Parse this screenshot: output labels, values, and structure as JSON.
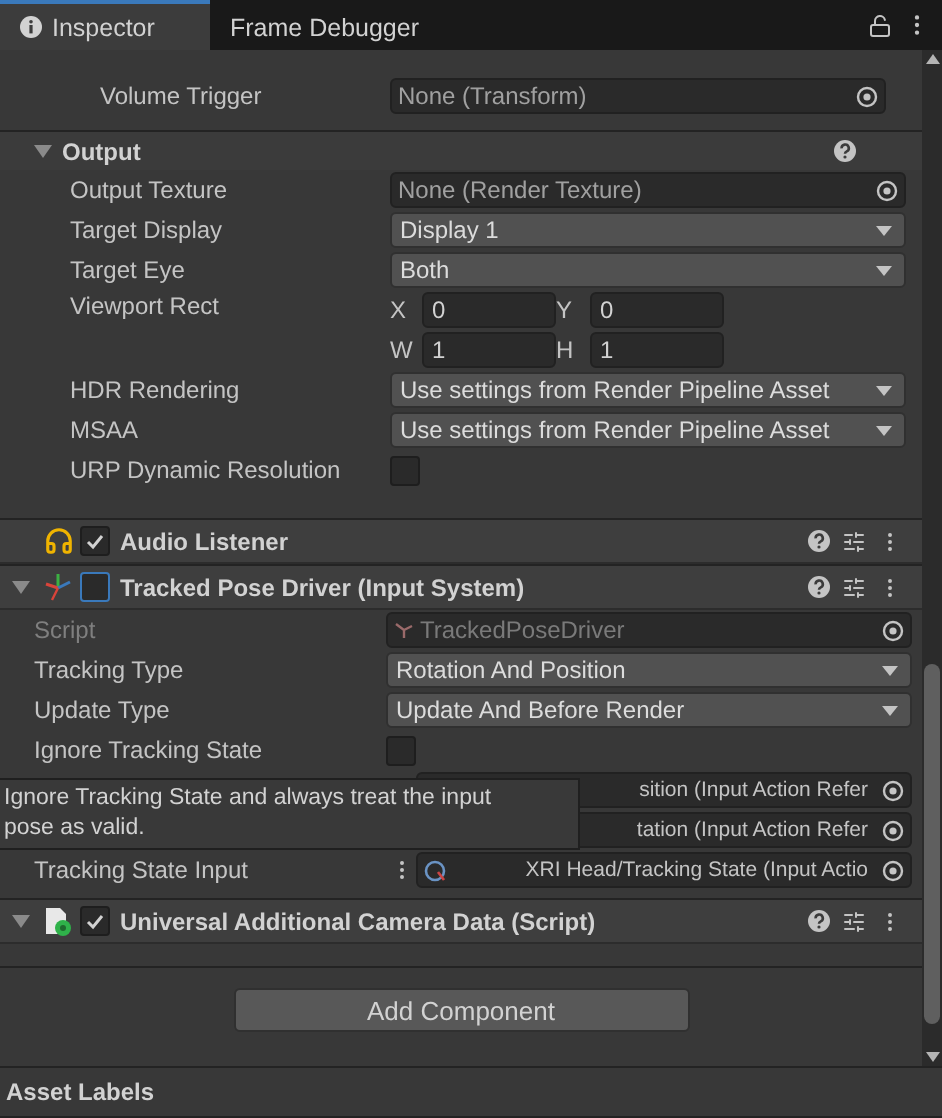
{
  "tabs": [
    {
      "label": "Inspector",
      "selected": true
    },
    {
      "label": "Frame Debugger",
      "selected": false
    }
  ],
  "camera_rows": [
    {
      "kind": "object",
      "label": "Volume Trigger",
      "value": "None (Transform)"
    }
  ],
  "output": {
    "title": "Output",
    "expanded": true,
    "rows": [
      {
        "kind": "object",
        "label": "Output Texture",
        "value": "None (Render Texture)"
      },
      {
        "kind": "dropdown",
        "label": "Target Display",
        "value": "Display 1"
      },
      {
        "kind": "dropdown",
        "label": "Target Eye",
        "value": "Both"
      },
      {
        "kind": "rect",
        "label": "Viewport Rect",
        "fields": [
          {
            "axis": "X",
            "value": "0"
          },
          {
            "axis": "Y",
            "value": "0"
          },
          {
            "axis": "W",
            "value": "1"
          },
          {
            "axis": "H",
            "value": "1"
          }
        ]
      },
      {
        "kind": "dropdown",
        "label": "HDR Rendering",
        "value": "Use settings from Render Pipeline Asset"
      },
      {
        "kind": "dropdown",
        "label": "MSAA",
        "value": "Use settings from Render Pipeline Asset"
      },
      {
        "kind": "checkbox",
        "label": "URP Dynamic Resolution",
        "checked": false
      }
    ]
  },
  "components": [
    {
      "kind": "listener",
      "title": "Audio Listener",
      "enabled": true
    },
    {
      "kind": "driver",
      "title": "Tracked Pose Driver (Input System)",
      "enabled": false,
      "expanded": true,
      "rows": [
        {
          "kind": "object",
          "label": "Script",
          "value": "TrackedPoseDriver",
          "disabled": true
        },
        {
          "kind": "dropdown",
          "label": "Tracking Type",
          "value": "Rotation And Position"
        },
        {
          "kind": "dropdown",
          "label": "Update Type",
          "value": "Update And Before Render"
        },
        {
          "kind": "checkbox",
          "label": "Ignore Tracking State",
          "checked": false
        },
        {
          "kind": "action",
          "value": "sition (Input Action Refer"
        },
        {
          "kind": "action",
          "value": "tation (Input Action Refer"
        },
        {
          "kind": "action",
          "label": "Tracking State Input",
          "value": "XRI Head/Tracking State (Input Actio"
        }
      ]
    },
    {
      "kind": "script",
      "title": "Universal Additional Camera Data (Script)",
      "enabled": true,
      "expanded": true
    }
  ],
  "add_button": "Add Component",
  "footer": {
    "title": "Asset Labels"
  },
  "tooltip": {
    "text": "Ignore Tracking State and always treat the input pose as valid."
  }
}
